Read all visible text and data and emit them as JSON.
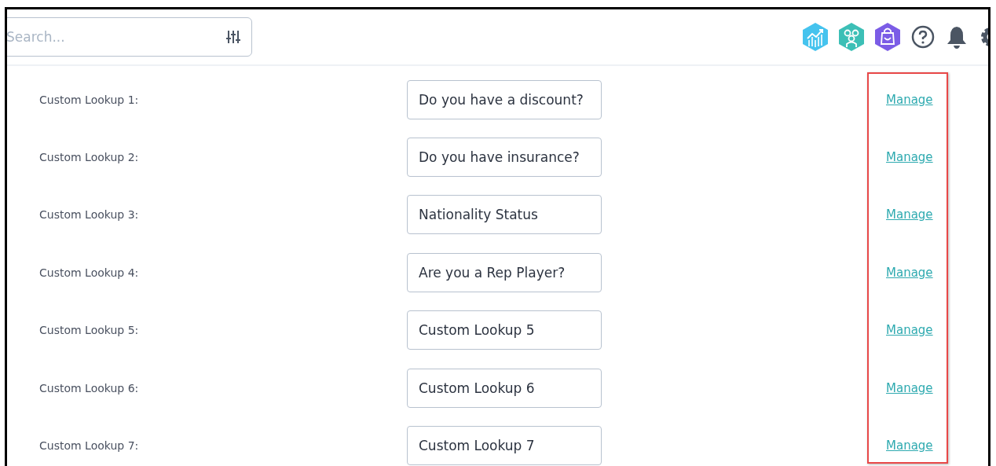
{
  "search": {
    "placeholder": "Search..."
  },
  "lookups": [
    {
      "label": "Custom Lookup 1:",
      "value": "Do you have a discount?",
      "action": "Manage"
    },
    {
      "label": "Custom Lookup 2:",
      "value": "Do you have insurance?",
      "action": "Manage"
    },
    {
      "label": "Custom Lookup 3:",
      "value": "Nationality Status",
      "action": "Manage"
    },
    {
      "label": "Custom Lookup 4:",
      "value": "Are you a Rep Player?",
      "action": "Manage"
    },
    {
      "label": "Custom Lookup 5:",
      "value": "Custom Lookup 5",
      "action": "Manage"
    },
    {
      "label": "Custom Lookup 6:",
      "value": "Custom Lookup 6",
      "action": "Manage"
    },
    {
      "label": "Custom Lookup 7:",
      "value": "Custom Lookup 7",
      "action": "Manage"
    }
  ]
}
